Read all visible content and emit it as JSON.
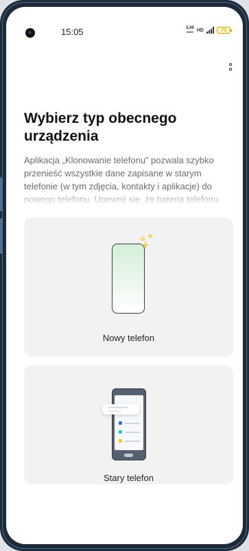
{
  "status_bar": {
    "time": "15:05",
    "net_speed_value": "5,00",
    "net_speed_unit": "KB/S",
    "volte": "HD",
    "battery": "79"
  },
  "page": {
    "title": "Wybierz typ obecnego urządzenia",
    "description": "Aplikacja „Klonowanie telefonu” pozwala szybko przenieść wszystkie dane zapisane w starym telefonie (w tym zdjęcia, kontakty i aplikacje) do nowego telefonu. Upewnij się, że bateria telefonu"
  },
  "options": {
    "new_phone": {
      "label": "Nowy telefon",
      "icon": "new-phone-icon"
    },
    "old_phone": {
      "label": "Stary telefon",
      "icon": "old-phone-icon"
    }
  },
  "colors": {
    "accent_green": "#d4efd9",
    "sparkle": "#f0c419",
    "card_bg": "#f2f2f2",
    "frame": "#1f2a38"
  }
}
